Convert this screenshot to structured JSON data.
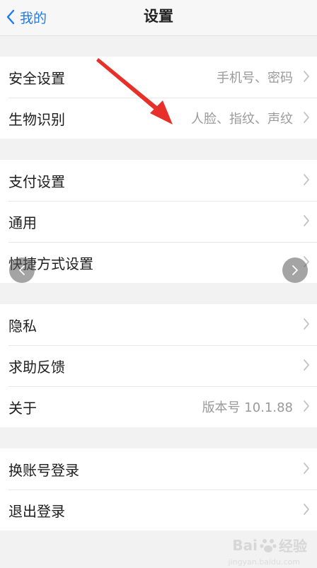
{
  "navbar": {
    "back_label": "我的",
    "title": "设置"
  },
  "groups": [
    {
      "items": [
        {
          "label": "安全设置",
          "detail": "手机号、密码"
        },
        {
          "label": "生物识别",
          "detail": "人脸、指纹、声纹"
        }
      ]
    },
    {
      "items": [
        {
          "label": "支付设置",
          "detail": ""
        },
        {
          "label": "通用",
          "detail": ""
        },
        {
          "label": "快捷方式设置",
          "detail": ""
        }
      ]
    },
    {
      "items": [
        {
          "label": "隐私",
          "detail": ""
        },
        {
          "label": "求助反馈",
          "detail": ""
        },
        {
          "label": "关于",
          "detail": "版本号 10.1.88"
        }
      ]
    },
    {
      "items": [
        {
          "label": "换账号登录",
          "detail": ""
        },
        {
          "label": "退出登录",
          "detail": ""
        }
      ]
    }
  ],
  "watermark": {
    "brand_a": "Bai",
    "brand_b": "经验",
    "url": "jingyan.baidu.com"
  },
  "colors": {
    "accent": "#1f7bf2",
    "annotation_arrow": "#e8302a"
  }
}
